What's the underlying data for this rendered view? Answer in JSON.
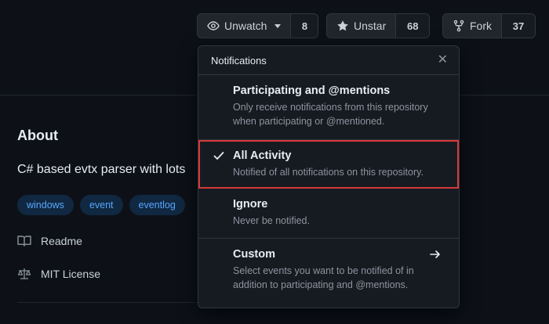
{
  "header": {
    "watch": {
      "label": "Unwatch",
      "count": "8"
    },
    "star": {
      "label": "Unstar",
      "count": "68"
    },
    "fork": {
      "label": "Fork",
      "count": "37"
    }
  },
  "about": {
    "title": "About",
    "description": "C# based evtx parser with lots",
    "topics": [
      "windows",
      "event",
      "eventlog"
    ],
    "readme": "Readme",
    "license": "MIT License"
  },
  "notifications": {
    "title": "Notifications",
    "items": [
      {
        "title": "Participating and @mentions",
        "desc": "Only receive notifications from this repository when participating or @mentioned."
      },
      {
        "title": "All Activity",
        "desc": "Notified of all notifications on this repository."
      },
      {
        "title": "Ignore",
        "desc": "Never be notified."
      },
      {
        "title": "Custom",
        "desc": "Select events you want to be notified of in addition to participating and @mentions."
      }
    ]
  }
}
